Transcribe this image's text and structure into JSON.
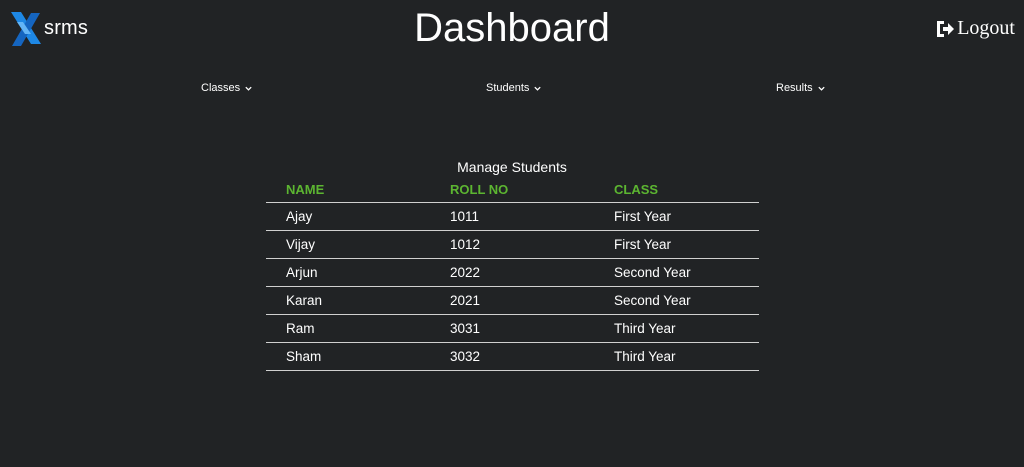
{
  "header": {
    "brand_text": "srms",
    "title": "Dashboard",
    "logout_label": "Logout",
    "logo_icon": "srms-logo-icon",
    "logout_icon": "sign-out-icon"
  },
  "nav": {
    "items": [
      {
        "label": "Classes",
        "icon": "chevron-down-icon"
      },
      {
        "label": "Students",
        "icon": "chevron-down-icon"
      },
      {
        "label": "Results",
        "icon": "chevron-down-icon"
      }
    ]
  },
  "students_table": {
    "title": "Manage Students",
    "columns": [
      "NAME",
      "ROLL NO",
      "CLASS"
    ],
    "rows": [
      [
        "Ajay",
        "1011",
        "First Year"
      ],
      [
        "Vijay",
        "1012",
        "First Year"
      ],
      [
        "Arjun",
        "2022",
        "Second Year"
      ],
      [
        "Karan",
        "2021",
        "Second Year"
      ],
      [
        "Ram",
        "3031",
        "Third Year"
      ],
      [
        "Sham",
        "3032",
        "Third Year"
      ]
    ]
  },
  "colors": {
    "background": "#212325",
    "header_accent": "#5cb531",
    "text": "#ffffff",
    "logo_blue": "#1e88e5",
    "logo_dark_blue": "#1565c0"
  }
}
